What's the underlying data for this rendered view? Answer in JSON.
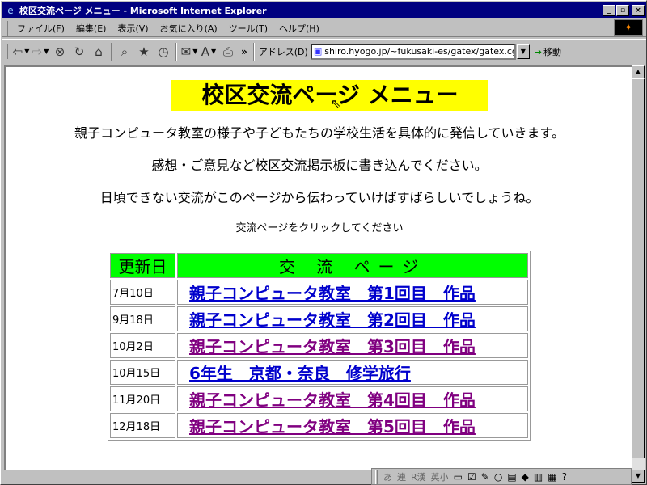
{
  "window": {
    "title": "校区交流ページ メニュー - Microsoft Internet Explorer",
    "icon": "ie-icon"
  },
  "menubar": {
    "items": [
      "ファイル(F)",
      "編集(E)",
      "表示(V)",
      "お気に入り(A)",
      "ツール(T)",
      "ヘルプ(H)"
    ]
  },
  "toolbar": {
    "address_label": "アドレス(D)",
    "address_value": "shiro.hyogo.jp/~fukusaki-es/gatex/gatex.cgi",
    "go_label": "移動"
  },
  "page": {
    "title": "校区交流ページ メニュー",
    "intro": [
      "親子コンピュータ教室の様子や子どもたちの学校生活を具体的に発信していきます。",
      "感想・ご意見など校区交流掲示板に書き込んでください。",
      "日頃できない交流がこのページから伝わっていけばすばらしいでしょうね。"
    ],
    "instruction": "交流ページをクリックしてください",
    "table": {
      "headers": [
        "更新日",
        "交 流 ページ"
      ],
      "rows": [
        {
          "date": "7月10日",
          "label": "親子コンピュータ教室　第1回目　作品",
          "visited": false
        },
        {
          "date": "9月18日",
          "label": "親子コンピュータ教室　第2回目　作品",
          "visited": false
        },
        {
          "date": "10月2日",
          "label": "親子コンピュータ教室　第3回目　作品",
          "visited": true
        },
        {
          "date": "10月15日",
          "label": "6年生　京都・奈良　修学旅行",
          "visited": false
        },
        {
          "date": "11月20日",
          "label": "親子コンピュータ教室　第4回目　作品",
          "visited": true
        },
        {
          "date": "12月18日",
          "label": "親子コンピュータ教室　第5回目　作品",
          "visited": true
        }
      ]
    }
  },
  "statusbar": {
    "ime_items": [
      "あ",
      "連",
      "R漢",
      "英小"
    ]
  },
  "colors": {
    "titlebar": "#000080",
    "title_highlight": "#ffff00",
    "table_header": "#00ff00",
    "link": "#0000cc",
    "visited_link": "#800080"
  }
}
